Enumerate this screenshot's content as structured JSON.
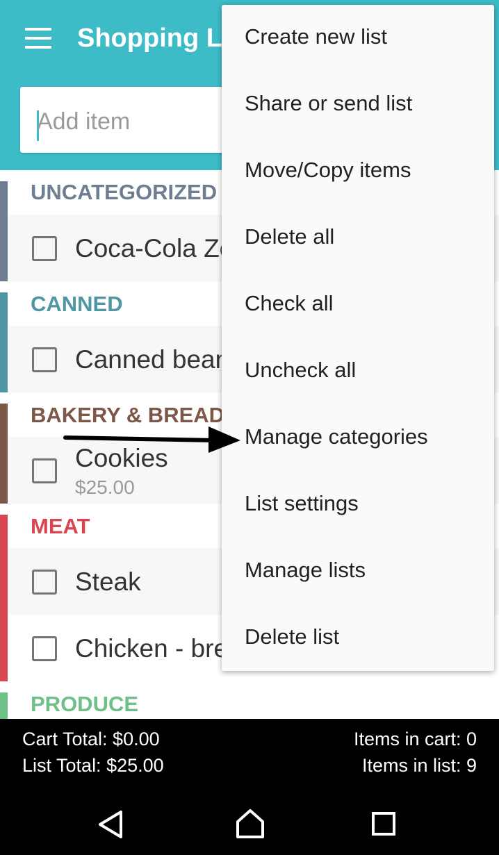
{
  "header": {
    "title": "Shopping Li",
    "add_item_placeholder": "Add item",
    "menu_icon": "hamburger-menu-icon",
    "background": "#3dbcc8"
  },
  "categories": [
    {
      "name": "UNCATEGORIZED",
      "color": "#6f7d92",
      "items": [
        {
          "name": "Coca-Cola Ze",
          "checked": false
        }
      ]
    },
    {
      "name": "CANNED",
      "color": "#4f97a3",
      "items": [
        {
          "name": "Canned bean",
          "checked": false
        }
      ]
    },
    {
      "name": "BAKERY & BREAD",
      "color": "#7d5747",
      "items": [
        {
          "name": "Cookies",
          "price": "$25.00",
          "checked": false
        }
      ]
    },
    {
      "name": "MEAT",
      "color": "#d9464f",
      "items": [
        {
          "name": "Steak",
          "checked": false
        },
        {
          "name": "Chicken - bre",
          "checked": false
        }
      ]
    },
    {
      "name": "PRODUCE",
      "color": "#6fbf88",
      "items": []
    }
  ],
  "overflow_menu": {
    "items": [
      "Create new list",
      "Share or send list",
      "Move/Copy items",
      "Delete all",
      "Check all",
      "Uncheck all",
      "Manage categories",
      "List settings",
      "Manage lists",
      "Delete list"
    ],
    "highlighted": "Manage categories"
  },
  "footer": {
    "cart_total": "Cart Total: $0.00",
    "list_total": "List Total: $25.00",
    "items_in_cart": "Items in cart: 0",
    "items_in_list": "Items in list: 9"
  },
  "nav": {
    "back_icon": "back-triangle-icon",
    "home_icon": "home-icon",
    "recents_icon": "recents-square-icon"
  }
}
